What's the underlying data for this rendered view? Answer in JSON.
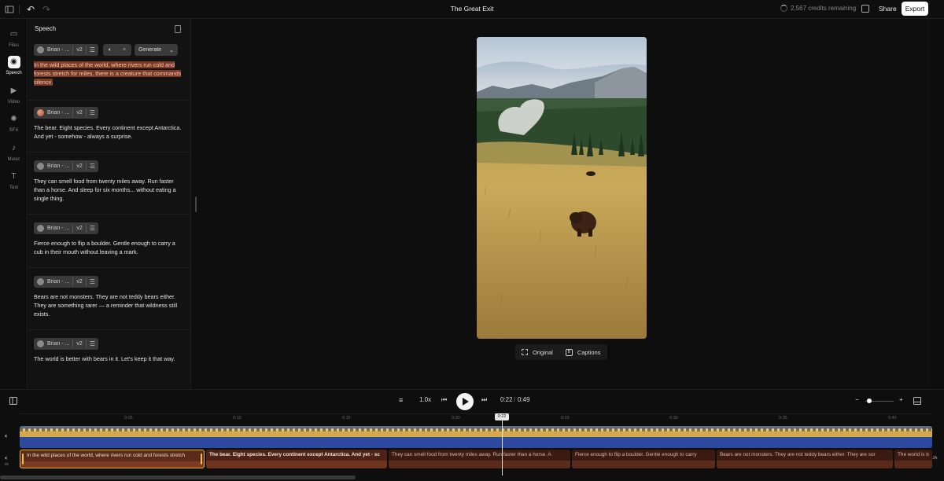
{
  "header": {
    "title": "The Great Exit",
    "credits": "2,567 credits remaining",
    "share_label": "Share",
    "export_label": "Export",
    "undo_icon": "↶",
    "redo_icon": "↷"
  },
  "rail": [
    {
      "label": "Files",
      "icon": "folder-icon",
      "glyph": "▭"
    },
    {
      "label": "Speech",
      "icon": "speech-icon",
      "glyph": "◉",
      "active": true
    },
    {
      "label": "Video",
      "icon": "video-icon",
      "glyph": "▶"
    },
    {
      "label": "SFX",
      "icon": "sfx-icon",
      "glyph": "✺"
    },
    {
      "label": "Music",
      "icon": "music-icon",
      "glyph": "♪"
    },
    {
      "label": "Text",
      "icon": "text-icon",
      "glyph": "T"
    }
  ],
  "speech": {
    "title": "Speech",
    "generate_label": "Generate",
    "blocks": [
      {
        "voice": "Brian - ...",
        "model": "v2",
        "text": "In the wild places of the world, where rivers run cold and forests stretch for miles, there is a creature that commands silence."
      },
      {
        "voice": "Brian - ...",
        "model": "v2",
        "text": "The bear. Eight species. Every continent except Antarctica. And yet - somehow - always a surprise."
      },
      {
        "voice": "Brian - ...",
        "model": "v2",
        "text": "They can smell food from twenty miles away. Run faster than a horse. And sleep for six months... without eating a single thing."
      },
      {
        "voice": "Brian - ...",
        "model": "v2",
        "text": "Fierce enough to flip a boulder. Gentle enough to carry a cub in their mouth without leaving a mark."
      },
      {
        "voice": "Brian - ...",
        "model": "v2",
        "text": "Bears are not monsters. They are not teddy bears either. They are something rarer — a reminder that wildness still exists."
      },
      {
        "voice": "Brian - ...",
        "model": "v2",
        "text": "The world is better with bears in it. Let's keep it that way."
      }
    ]
  },
  "preview": {
    "original_label": "Original",
    "captions_label": "Captions",
    "captions_badge": "B"
  },
  "transport": {
    "speed": "1.0x",
    "current": "0:22",
    "separator": "/",
    "total": "0:49",
    "zoom_minus": "−",
    "zoom_plus": "+",
    "zoom_level": 0.05
  },
  "timeline": {
    "ticks": [
      "0:05",
      "0:10",
      "0:15",
      "0:20",
      "0:25",
      "0:30",
      "0:35",
      "0:40"
    ],
    "playhead_label": "0:22",
    "clips": [
      "In the wild places of the world, where rivers run cold and forests stretch",
      "The bear. Eight species. Every continent except Antarctica. And yet - sc",
      "They can smell food from twenty miles away. Run faster than a horse. A",
      "Fierce enough to flip a boulder. Gentle enough to carry",
      "Bears are not monsters. They are not teddy bears either. They are sor",
      "The world is b"
    ],
    "edge_badge": "JA",
    "track_label_cc": "cc"
  }
}
